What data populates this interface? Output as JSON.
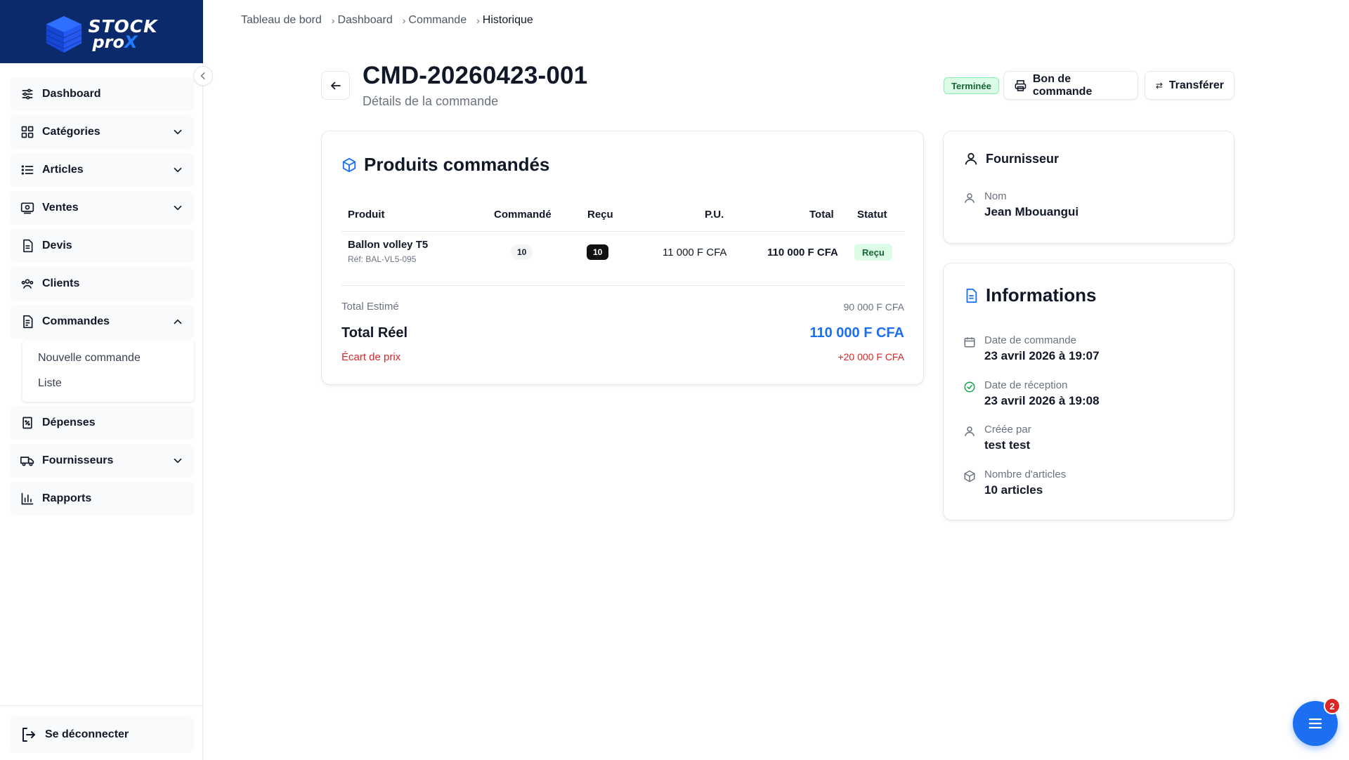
{
  "brand": {
    "logo_word1": "STOCK",
    "logo_word2_a": "pro",
    "logo_word2_b": "X"
  },
  "sidebar": {
    "items": [
      {
        "label": "Dashboard",
        "icon": "sliders-icon"
      },
      {
        "label": "Catégories",
        "icon": "grid-icon"
      },
      {
        "label": "Articles",
        "icon": "list-icon"
      },
      {
        "label": "Ventes",
        "icon": "cash-register-icon"
      },
      {
        "label": "Devis",
        "icon": "document-icon"
      },
      {
        "label": "Clients",
        "icon": "users-icon"
      },
      {
        "label": "Commandes",
        "icon": "orders-icon"
      },
      {
        "label": "Dépenses",
        "icon": "expense-icon"
      },
      {
        "label": "Fournisseurs",
        "icon": "truck-icon"
      },
      {
        "label": "Rapports",
        "icon": "bar-chart-icon"
      }
    ],
    "commandes_sub": [
      "Nouvelle commande",
      "Liste"
    ],
    "logout_label": "Se déconnecter"
  },
  "breadcrumb": [
    "Tableau de bord",
    "Dashboard",
    "Commande",
    "Historique"
  ],
  "header": {
    "title": "CMD-20260423-001",
    "subtitle": "Détails de la commande",
    "status": "Terminée",
    "print_label": "Bon de commande",
    "transfer_label": "Transférer"
  },
  "products": {
    "title": "Produits commandés",
    "columns": [
      "Produit",
      "Commandé",
      "Reçu",
      "P.U.",
      "Total",
      "Statut"
    ],
    "rows": [
      {
        "name": "Ballon volley T5",
        "ref": "Réf: BAL-VL5-095",
        "ordered": "10",
        "received": "10",
        "unit_price": "11 000 F CFA",
        "total": "110 000 F CFA",
        "status": "Reçu"
      }
    ],
    "estimated_label": "Total Estimé",
    "estimated_value": "90 000 F CFA",
    "real_label": "Total Réel",
    "real_value": "110 000 F CFA",
    "gap_label": "Écart de prix",
    "gap_value": "+20 000 F CFA"
  },
  "supplier": {
    "title": "Fournisseur",
    "name_label": "Nom",
    "name_value": "Jean Mbouangui"
  },
  "info": {
    "title": "Informations",
    "fields": [
      {
        "label": "Date de commande",
        "value": "23 avril 2026 à 19:07",
        "icon": "calendar-icon"
      },
      {
        "label": "Date de réception",
        "value": "23 avril 2026 à 19:08",
        "icon": "check-circle-icon"
      },
      {
        "label": "Créée par",
        "value": "test test",
        "icon": "user-icon"
      },
      {
        "label": "Nombre d'articles",
        "value": "10 articles",
        "icon": "box-icon"
      }
    ]
  },
  "fab": {
    "badge": "2"
  },
  "colors": {
    "brand": "#0b2a6b",
    "accent": "#1d6ff2",
    "success": "#166534",
    "danger": "#dc2626"
  }
}
